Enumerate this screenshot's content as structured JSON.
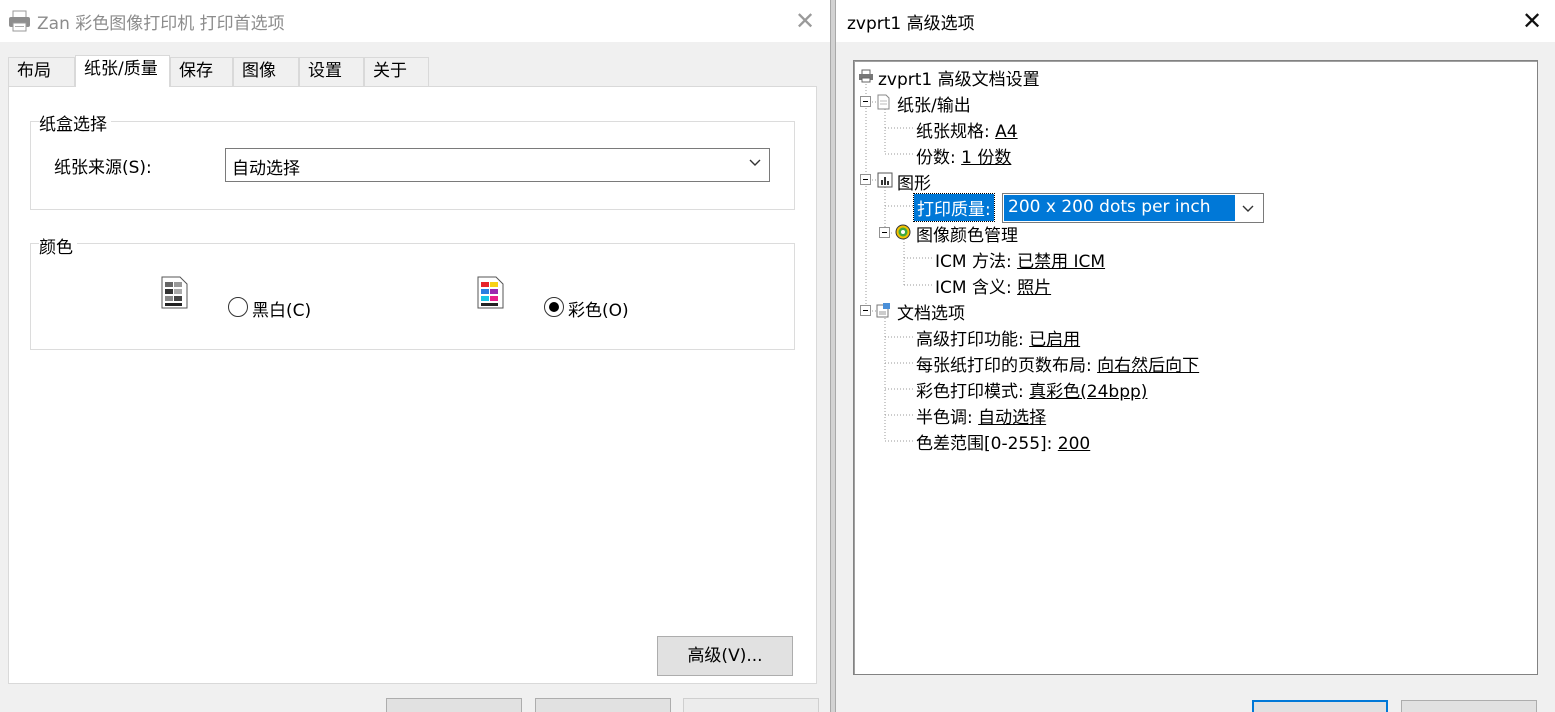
{
  "left_dialog": {
    "title": "Zan 彩色图像打印机 打印首选项",
    "tabs": [
      {
        "label": "布局"
      },
      {
        "label": "纸张/质量"
      },
      {
        "label": "保存"
      },
      {
        "label": "图像"
      },
      {
        "label": "设置"
      },
      {
        "label": "关于"
      }
    ],
    "active_tab": "纸张/质量",
    "tray_group": {
      "title": "纸盒选择",
      "source_label": "纸张来源(S):",
      "source_value": "自动选择"
    },
    "color_group": {
      "title": "颜色",
      "bw_label": "黑白(C)",
      "color_label": "彩色(O)",
      "selected": "color"
    },
    "advanced_button": "高级(V)..."
  },
  "right_dialog": {
    "title": "zvprt1 高级选项",
    "tree": {
      "root": "zvprt1 高级文档设置",
      "paper_output": {
        "label": "纸张/输出",
        "paper_size_label": "纸张规格:",
        "paper_size_value": "A4",
        "copies_label": "份数:",
        "copies_value": "1 份数"
      },
      "graphics": {
        "label": "图形",
        "quality_label": "打印质量:",
        "quality_value": "200 x 200 dots per inch",
        "icm": {
          "label": "图像颜色管理",
          "method_label": "ICM 方法:",
          "method_value": "已禁用 ICM",
          "intent_label": "ICM 含义:",
          "intent_value": "照片"
        }
      },
      "document_options": {
        "label": "文档选项",
        "items": [
          {
            "label": "高级打印功能:",
            "value": "已启用"
          },
          {
            "label": "每张纸打印的页数布局:",
            "value": "向右然后向下"
          },
          {
            "label": "彩色打印模式:",
            "value": "真彩色(24bpp)"
          },
          {
            "label": "半色调:",
            "value": "自动选择"
          },
          {
            "label": "色差范围[0-255]:",
            "value": "200"
          }
        ]
      }
    }
  },
  "icons": [
    "printer-icon",
    "close-icon",
    "chevron-down-icon",
    "grayscale-doc-icon",
    "color-doc-icon",
    "tree-printer-icon",
    "paper-icon",
    "chart-icon",
    "color-management-icon",
    "document-options-icon"
  ],
  "colors": {
    "selection": "#0078d7",
    "dialog_bg": "#f0f0f0"
  }
}
